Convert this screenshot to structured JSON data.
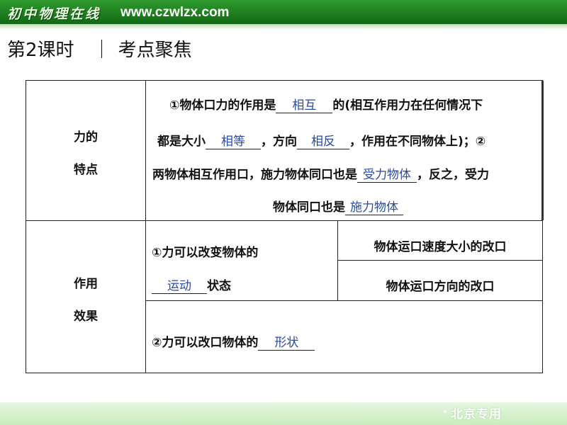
{
  "banner": {
    "logo_text": "初中物理在线",
    "url": "www.czwlzx.com"
  },
  "heading": {
    "lesson": "第2课时",
    "separator": "｜",
    "title": "考点聚焦"
  },
  "table": {
    "row1": {
      "label_line1": "力的",
      "label_line2": "特点",
      "line1_pre": "①物体口力的作用是",
      "blank1": "相互",
      "line1_post": "的(相互作用力在任何情况下",
      "line2_pre": "都是大小",
      "blank2": "相等",
      "line2_mid": "，方向",
      "blank3": "相反",
      "line2_post": "，作用在不同物体上)；②",
      "line3_pre": "两物体相互作用口，施力物体同口也是",
      "blank4": "受力物体",
      "line3_post": "，反之，受力",
      "line4_pre": "物体同口也是",
      "blank5": "施力物体"
    },
    "row2": {
      "label_line1": "作用",
      "label_line2": "效果",
      "left_line1": "①力可以改变物体的",
      "blank6": "运动",
      "left_line2_post": "状态",
      "right_top": "物体运口速度大小的改口",
      "right_bottom": "物体运口方向的改口",
      "bottom_pre": "②力可以改口物体的",
      "blank7": "形状"
    }
  },
  "footer": {
    "note": "北京专用"
  }
}
